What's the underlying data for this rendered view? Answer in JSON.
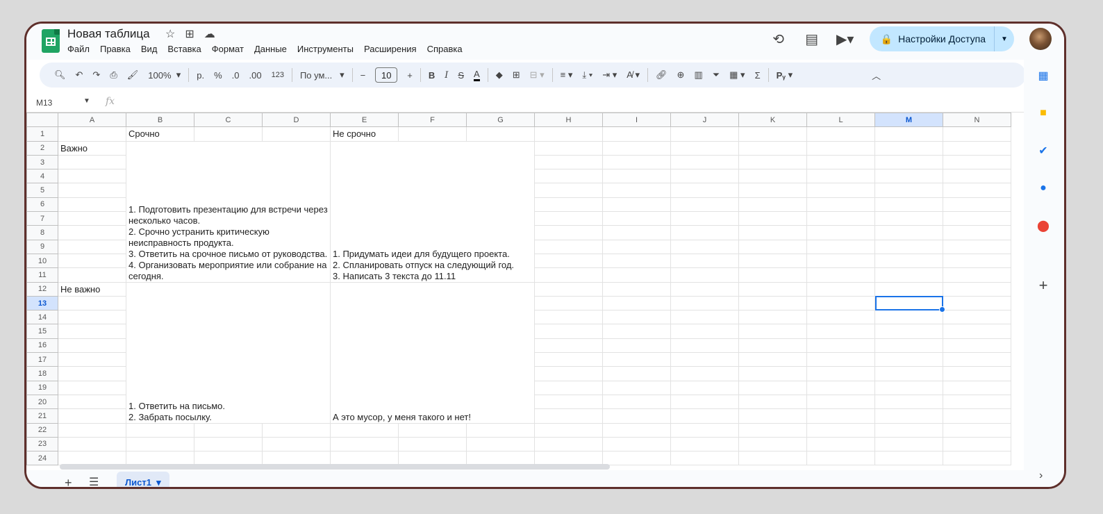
{
  "app": {
    "title": "Новая таблица",
    "menu": [
      "Файл",
      "Правка",
      "Вид",
      "Вставка",
      "Формат",
      "Данные",
      "Инструменты",
      "Расширения",
      "Справка"
    ],
    "share_label": "Настройки Доступа"
  },
  "toolbar": {
    "zoom": "100%",
    "currency": "р.",
    "percent": "%",
    "dec_decrease": ".0",
    "dec_increase": ".00",
    "number_format": "123",
    "font": "По ум...",
    "font_size": "10",
    "bold": "B",
    "italic": "I",
    "strike": "S",
    "text_color": "A",
    "sum": "Σ",
    "input_tools": "Рᵧ"
  },
  "formula_bar": {
    "name_box": "M13",
    "fx": "fx",
    "value": ""
  },
  "sheet": {
    "columns": [
      "A",
      "B",
      "C",
      "D",
      "E",
      "F",
      "G",
      "H",
      "I",
      "J",
      "K",
      "L",
      "M",
      "N"
    ],
    "selected_column": "M",
    "selected_row": 13,
    "rows": [
      "1",
      "2",
      "3",
      "4",
      "5",
      "6",
      "7",
      "8",
      "9",
      "10",
      "11",
      "12",
      "13",
      "14",
      "15",
      "16",
      "17",
      "18",
      "19",
      "20",
      "21",
      "22",
      "23",
      "24"
    ],
    "cells": {
      "B1": "Срочно",
      "E1": "Не срочно",
      "A2": "Важно",
      "A12": "Не важно",
      "B2_block": "1. Подготовить презентацию для встречи через несколько часов.\n2. Срочно устранить критическую неисправность продукта.\n3. Ответить на срочное письмо от руководства.\n4. Организовать мероприятие или собрание на сегодня.",
      "E2_block": "1. Придумать идеи для будущего проекта.\n2. Спланировать отпуск на следующий год.\n3. Написать 3 текста до 11.11",
      "B12_block": "1. Ответить на письмо.\n2. Забрать посылку.",
      "E12_block": "А это мусор, у меня такого и нет!"
    }
  },
  "tabs": {
    "sheet1": "Лист1"
  },
  "colors": {
    "accent": "#1a73e8",
    "share_bg": "#c2e7ff",
    "frame": "#5e2f2b"
  }
}
